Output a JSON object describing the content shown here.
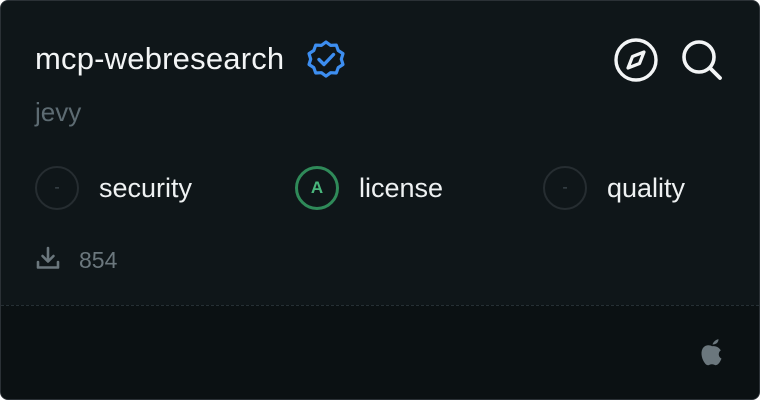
{
  "package": {
    "name": "mcp-webresearch",
    "author": "jevy",
    "verified_icon": "verified-badge-icon"
  },
  "actions": [
    {
      "icon": "compass-icon"
    },
    {
      "icon": "search-icon"
    }
  ],
  "scores": [
    {
      "grade": "-",
      "label": "security",
      "state": "none"
    },
    {
      "grade": "A",
      "label": "license",
      "state": "good"
    },
    {
      "grade": "-",
      "label": "quality",
      "state": "none"
    }
  ],
  "downloads": {
    "icon": "download-icon",
    "count": "854"
  },
  "footer": {
    "platform_icon": "apple-icon"
  },
  "colors": {
    "background": "#0f1619",
    "footer_background": "#0b1113",
    "verified": "#3d8ef0",
    "grade_good": "#2f8a59",
    "muted_text": "#5d6b72"
  }
}
